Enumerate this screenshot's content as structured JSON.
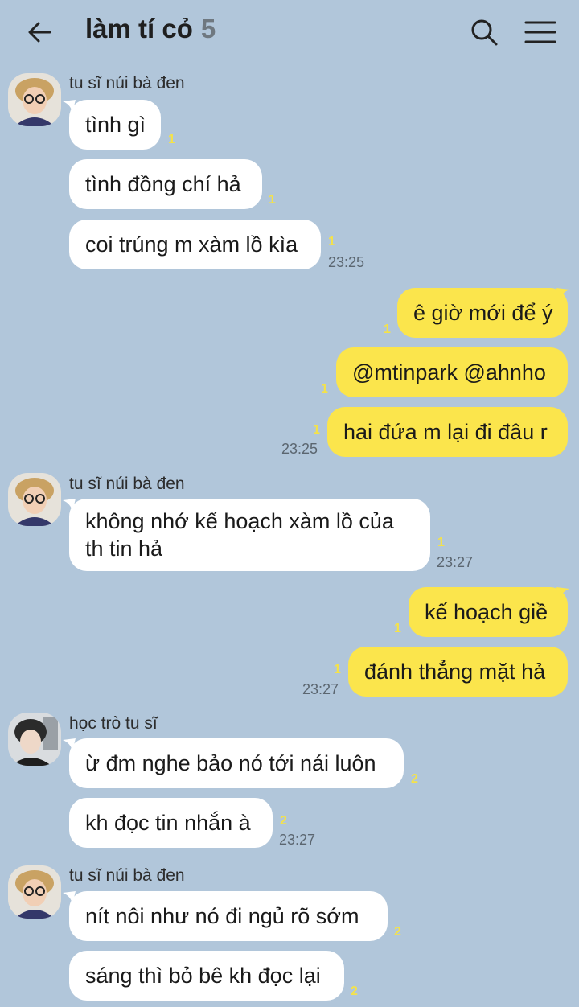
{
  "header": {
    "title": "làm tí cỏ",
    "member_count": "5",
    "back_icon": "back-arrow-icon",
    "search_icon": "search-icon",
    "menu_icon": "menu-icon"
  },
  "colors": {
    "background": "#b1c6da",
    "incoming_bubble": "#ffffff",
    "outgoing_bubble": "#fbe54c",
    "unread_count": "#f4e24a"
  },
  "groups": [
    {
      "sender": "tu sĩ núi bà đen",
      "messages": [
        {
          "text": "tình gì",
          "unread": "1"
        },
        {
          "text": "tình đồng chí hả",
          "unread": "1"
        },
        {
          "text": "coi trúng m xàm lồ kìa",
          "unread": "1",
          "time": "23:25"
        }
      ]
    },
    {
      "sender": "me",
      "messages": [
        {
          "text": "ê giờ mới để ý",
          "unread": "1"
        },
        {
          "text": "@mtinpark @ahnho",
          "unread": "1"
        },
        {
          "text": "hai đứa m lại đi đâu r",
          "unread": "1",
          "time": "23:25"
        }
      ]
    },
    {
      "sender": "tu sĩ núi bà đen",
      "messages": [
        {
          "line1": "không nhớ kế hoạch xàm lồ của",
          "line2": "th tin hả",
          "unread": "1",
          "time": "23:27"
        }
      ]
    },
    {
      "sender": "me",
      "messages": [
        {
          "text": "kế hoạch giề",
          "unread": "1"
        },
        {
          "text": "đánh thẳng mặt hả",
          "unread": "1",
          "time": "23:27"
        }
      ]
    },
    {
      "sender": "học trò tu sĩ",
      "messages": [
        {
          "text": "ừ đm nghe bảo nó tới nái luôn",
          "unread": "2"
        },
        {
          "text": "kh đọc tin nhắn à",
          "unread": "2",
          "time": "23:27"
        }
      ]
    },
    {
      "sender": "tu sĩ núi bà đen",
      "messages": [
        {
          "text": "nít nôi như nó đi ngủ rõ sớm",
          "unread": "2"
        },
        {
          "text": "sáng thì bỏ bê kh đọc lại",
          "unread": "2"
        }
      ]
    }
  ]
}
